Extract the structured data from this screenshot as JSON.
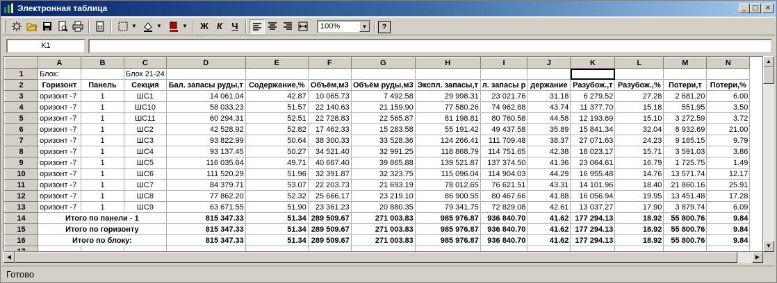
{
  "window": {
    "title": "Электронная таблица",
    "min_glyph": "_",
    "max_glyph": "□",
    "close_glyph": "×"
  },
  "toolbar": {
    "bold": "Ж",
    "italic": "К",
    "underline": "Ч",
    "zoom": "100%",
    "help_glyph": "?"
  },
  "formula_bar": {
    "cell_ref": "K1",
    "value": ""
  },
  "columns": [
    "A",
    "B",
    "C",
    "D",
    "E",
    "F",
    "G",
    "H",
    "I",
    "J",
    "K",
    "L",
    "M",
    "N"
  ],
  "rows": [
    [
      "Блок:",
      "",
      "Блок 21-24",
      "",
      "",
      "",
      "",
      "",
      "",
      "",
      "",
      "",
      "",
      ""
    ],
    [
      "Горизонт",
      "Панель",
      "Секция",
      "Бал. запасы руды,т",
      "Содержание,%",
      "Объём,м3",
      "Объём руды,м3",
      "Экспл. запасы,т",
      "л. запасы р",
      "держание",
      "Разубож.,т",
      "Разубож.,%",
      "Потери,т",
      "Потери,%"
    ],
    [
      "оризонт -7",
      "1",
      "ШС1",
      "14 061.04",
      "42.87",
      "10 065.73",
      "7 492.58",
      "29 998.31",
      "23 021.76",
      "31.18",
      "6 279.52",
      "27.28",
      "2 681.20",
      "6.00"
    ],
    [
      "оризонт -7",
      "1",
      "ШС10",
      "58 033.23",
      "51.57",
      "22 140.63",
      "21 159.90",
      "77 580.26",
      "74 962.88",
      "43.74",
      "11 377.70",
      "15.18",
      "551.95",
      "3.50"
    ],
    [
      "оризонт -7",
      "1",
      "ШС11",
      "60 294.31",
      "52.51",
      "22 728.83",
      "22 565.87",
      "81 198.81",
      "80 760.58",
      "44.58",
      "12 193.69",
      "15.10",
      "3 272.59",
      "3.72"
    ],
    [
      "оризонт -7",
      "1",
      "ШС2",
      "42 528.92",
      "52.82",
      "17 462.33",
      "15 283.58",
      "55 191.42",
      "49 437.58",
      "35.89",
      "15 841.34",
      "32.04",
      "8 932.69",
      "21.00"
    ],
    [
      "оризонт -7",
      "1",
      "ШС3",
      "93 822.99",
      "50.64",
      "38 300.33",
      "33 528.36",
      "124 266.41",
      "111 709.48",
      "38.37",
      "27 071.63",
      "24.23",
      "9 185.15",
      "9.79"
    ],
    [
      "оризонт -7",
      "1",
      "ШС4",
      "93 137.45",
      "50.27",
      "34 521.40",
      "32 991.25",
      "118 868.79",
      "114 751.65",
      "42.38",
      "18 023.17",
      "15.71",
      "3 591.03",
      "3.86"
    ],
    [
      "оризонт -7",
      "1",
      "ШС5",
      "116 035.64",
      "49.71",
      "40 667.40",
      "39 865.88",
      "139 521.87",
      "137 374.50",
      "41.36",
      "23 064.61",
      "16.79",
      "1 725.75",
      "1.49"
    ],
    [
      "оризонт -7",
      "1",
      "ШС6",
      "111 520.29",
      "51.96",
      "32 391.87",
      "32 323.75",
      "115 096.04",
      "114 904.03",
      "44.29",
      "16 955.48",
      "14.76",
      "13 571.74",
      "12.17"
    ],
    [
      "оризонт -7",
      "1",
      "ШС7",
      "84 379.71",
      "53.07",
      "22 203.73",
      "21 693.19",
      "78 012.65",
      "76 621.51",
      "43.31",
      "14 101.96",
      "18.40",
      "21 860.16",
      "25.91"
    ],
    [
      "оризонт -7",
      "1",
      "ШС8",
      "77 862.20",
      "52.32",
      "25 666.17",
      "23 219.10",
      "86 900.55",
      "80 467.66",
      "41.88",
      "16 056.94",
      "19.95",
      "13 451.48",
      "17.28"
    ],
    [
      "оризонт -7",
      "1",
      "ШС9",
      "63 671.55",
      "51.90",
      "23 361.23",
      "20 880.35",
      "79 341.75",
      "72 829.08",
      "42.61",
      "13 037.27",
      "17.90",
      "3 879.74",
      "6.09"
    ],
    [
      "Итого по панели - 1",
      "",
      "",
      "815 347.33",
      "51.34",
      "289 509.67",
      "271 003.83",
      "985 976.87",
      "936 840.70",
      "41.62",
      "177 294.13",
      "18.92",
      "55 800.76",
      "9.84"
    ],
    [
      "Итого по горизонту",
      "",
      "",
      "815 347.33",
      "51.34",
      "289 509.67",
      "271 003.83",
      "985 976.87",
      "936 840.70",
      "41.62",
      "177 294.13",
      "18.92",
      "55 800.76",
      "9.84"
    ],
    [
      "Итого по блоку:",
      "",
      "",
      "815 347.33",
      "51.34",
      "289 509.67",
      "271 003.83",
      "985 976.87",
      "936 840.70",
      "41.62",
      "177 294.13",
      "18.92",
      "55 800.76",
      "9.84"
    ],
    [
      "",
      "",
      "",
      "",
      "",
      "",
      "",
      "",
      "",
      "",
      "",
      "",
      "",
      ""
    ]
  ],
  "row_numbers": [
    "1",
    "2",
    "3",
    "4",
    "5",
    "6",
    "7",
    "8",
    "9",
    "10",
    "11",
    "12",
    "13",
    "14",
    "15",
    "16",
    "17"
  ],
  "selected_cell": "K1",
  "status": {
    "text": "Готово"
  },
  "scroll_glyphs": {
    "up": "▲",
    "down": "▼",
    "left": "◀",
    "right": "▶"
  },
  "colors": {
    "title_start": "#0a246a",
    "title_end": "#a6caf0",
    "chrome": "#d4d0c8"
  }
}
